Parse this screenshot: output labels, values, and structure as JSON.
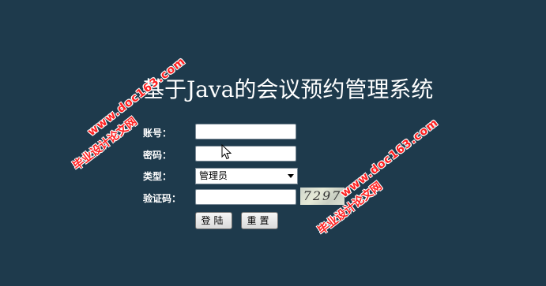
{
  "page": {
    "title": "基于Java的会议预约管理系统"
  },
  "form": {
    "account_label": "账号：",
    "account_value": "",
    "password_label": "密码：",
    "password_value": "",
    "type_label": "类型：",
    "type_selected": "管理员",
    "captcha_label": "验证码：",
    "captcha_value": "",
    "captcha_image_text": "7297"
  },
  "buttons": {
    "login_label": "登陆",
    "reset_label": "重置"
  },
  "watermarks": {
    "line1_cn": "毕业设计论文网",
    "line1_url": "www.doc163.com",
    "line2_cn": "毕业设计论文网",
    "line2_url": "www.doc163.com"
  },
  "colors": {
    "background": "#1e3a4c",
    "watermark": "#ff2020"
  }
}
